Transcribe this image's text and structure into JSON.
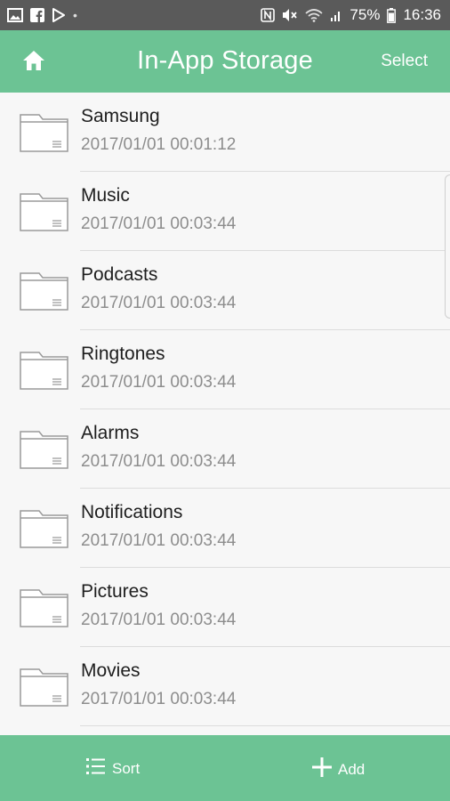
{
  "status_bar": {
    "battery": "75%",
    "time": "16:36",
    "left_icons": [
      "gallery-icon",
      "facebook-icon",
      "play-store-icon"
    ],
    "right_icons": [
      "nfc-icon",
      "mute-icon",
      "wifi-icon",
      "signal-icon",
      "battery-icon"
    ]
  },
  "app_bar": {
    "title": "In-App Storage",
    "select_label": "Select",
    "color": "#6cc394"
  },
  "folders": [
    {
      "name": "Samsung",
      "date": "2017/01/01 00:01:12"
    },
    {
      "name": "Music",
      "date": "2017/01/01 00:03:44"
    },
    {
      "name": "Podcasts",
      "date": "2017/01/01 00:03:44"
    },
    {
      "name": "Ringtones",
      "date": "2017/01/01 00:03:44"
    },
    {
      "name": "Alarms",
      "date": "2017/01/01 00:03:44"
    },
    {
      "name": "Notifications",
      "date": "2017/01/01 00:03:44"
    },
    {
      "name": "Pictures",
      "date": "2017/01/01 00:03:44"
    },
    {
      "name": "Movies",
      "date": "2017/01/01 00:03:44"
    }
  ],
  "bottom_bar": {
    "sort_label": "Sort",
    "add_label": "Add"
  }
}
